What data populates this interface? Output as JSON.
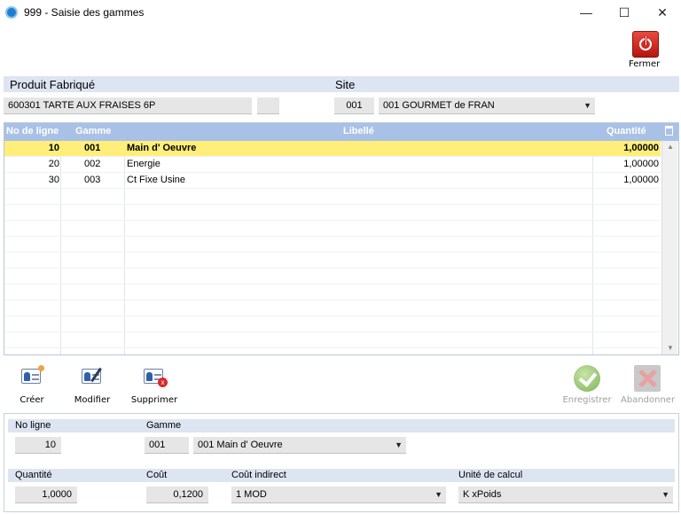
{
  "window": {
    "title": "999 - Saisie des gammes",
    "minimize": "—",
    "maximize": "☐",
    "close": "✕"
  },
  "fermer": {
    "label": "Fermer"
  },
  "header": {
    "produit_label": "Produit Fabriqué",
    "site_label": "Site",
    "produit_value": "600301  TARTE AUX FRAISES 6P",
    "produit_extra": "",
    "site_code": "001",
    "site_value": "001  GOURMET de FRAN"
  },
  "grid": {
    "columns": [
      "No de ligne",
      "Gamme",
      "Libellé",
      "Quantité"
    ],
    "rows": [
      {
        "no": "10",
        "gamme": "001",
        "libelle": "Main d' Oeuvre",
        "quantite": "1,00000",
        "selected": true
      },
      {
        "no": "20",
        "gamme": "002",
        "libelle": "Energie",
        "quantite": "1,00000",
        "selected": false
      },
      {
        "no": "30",
        "gamme": "003",
        "libelle": "Ct Fixe Usine",
        "quantite": "1,00000",
        "selected": false
      }
    ],
    "selected_color": "#ffef7a",
    "header_color": "#a9c1e6"
  },
  "toolbar": {
    "creer": "Créer",
    "modifier": "Modifier",
    "supprimer": "Supprimer",
    "enregistrer": "Enregistrer",
    "abandonner": "Abandonner"
  },
  "detail": {
    "no_ligne_label": "No ligne",
    "gamme_label": "Gamme",
    "no_ligne_value": "10",
    "gamme_code": "001",
    "gamme_value": "001  Main d' Oeuvre",
    "quantite_label": "Quantité",
    "cout_label": "Coût",
    "cout_indirect_label": "Coût indirect",
    "unite_label": "Unité de calcul",
    "quantite_value": "1,0000",
    "cout_value": "0,1200",
    "cout_indirect_value": "1 MOD",
    "unite_value": "K xPoids"
  }
}
